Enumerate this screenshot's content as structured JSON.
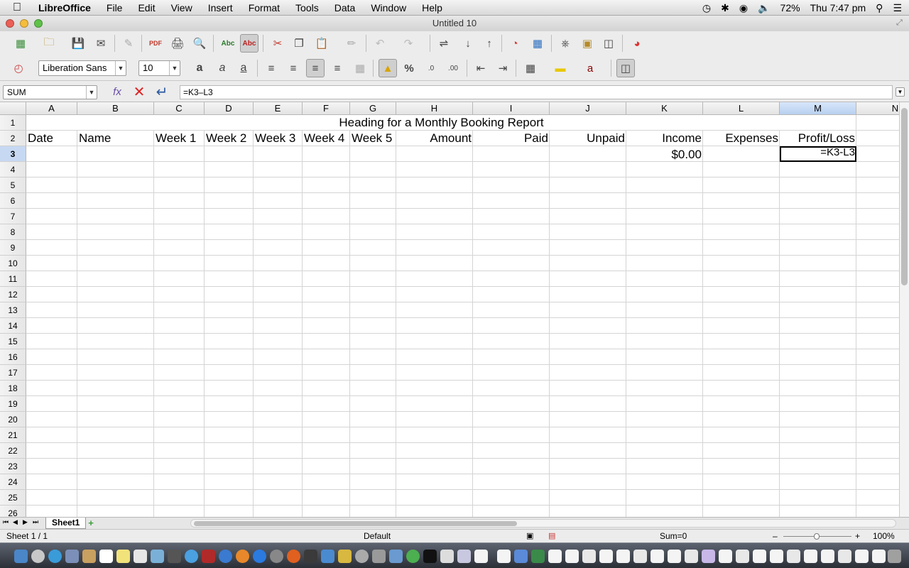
{
  "menubar": {
    "app": "LibreOffice",
    "items": [
      "File",
      "Edit",
      "View",
      "Insert",
      "Format",
      "Tools",
      "Data",
      "Window",
      "Help"
    ],
    "battery": "72%",
    "clock": "Thu 7:47 pm"
  },
  "window": {
    "title": "Untitled 10"
  },
  "toolbar": {
    "font_name": "Liberation Sans",
    "font_size": "10"
  },
  "formula_bar": {
    "name_box": "SUM",
    "formula": "=K3–L3"
  },
  "columns": [
    {
      "label": "A"
    },
    {
      "label": "B"
    },
    {
      "label": "C"
    },
    {
      "label": "D"
    },
    {
      "label": "E"
    },
    {
      "label": "F"
    },
    {
      "label": "G"
    },
    {
      "label": "H"
    },
    {
      "label": "I"
    },
    {
      "label": "J"
    },
    {
      "label": "K"
    },
    {
      "label": "L"
    },
    {
      "label": "M",
      "selected": true
    },
    {
      "label": "N"
    }
  ],
  "rows": [
    "1",
    "2",
    "3",
    "4",
    "5",
    "6",
    "7",
    "8",
    "9",
    "10",
    "11",
    "12",
    "13",
    "14",
    "15",
    "16",
    "17",
    "18",
    "19",
    "20",
    "21",
    "22",
    "23",
    "24",
    "25",
    "26"
  ],
  "selected_row": "3",
  "cells": {
    "title": "Heading for a Monthly Booking Report",
    "headers": {
      "A": "Date",
      "B": "Name",
      "C": "Week 1",
      "D": "Week 2",
      "E": "Week 3",
      "F": "Week 4",
      "G": "Week 5",
      "H": "Amount",
      "I": "Paid",
      "J": "Unpaid",
      "K": "Income",
      "L": "Expenses",
      "M": "Profit/Loss"
    },
    "K3": "$0.00",
    "M3": "=K3-L3"
  },
  "sheet_tab": "Sheet1",
  "statusbar": {
    "sheet_info": "Sheet 1 / 1",
    "page_style": "Default",
    "sum": "Sum=0",
    "zoom": "100%"
  }
}
